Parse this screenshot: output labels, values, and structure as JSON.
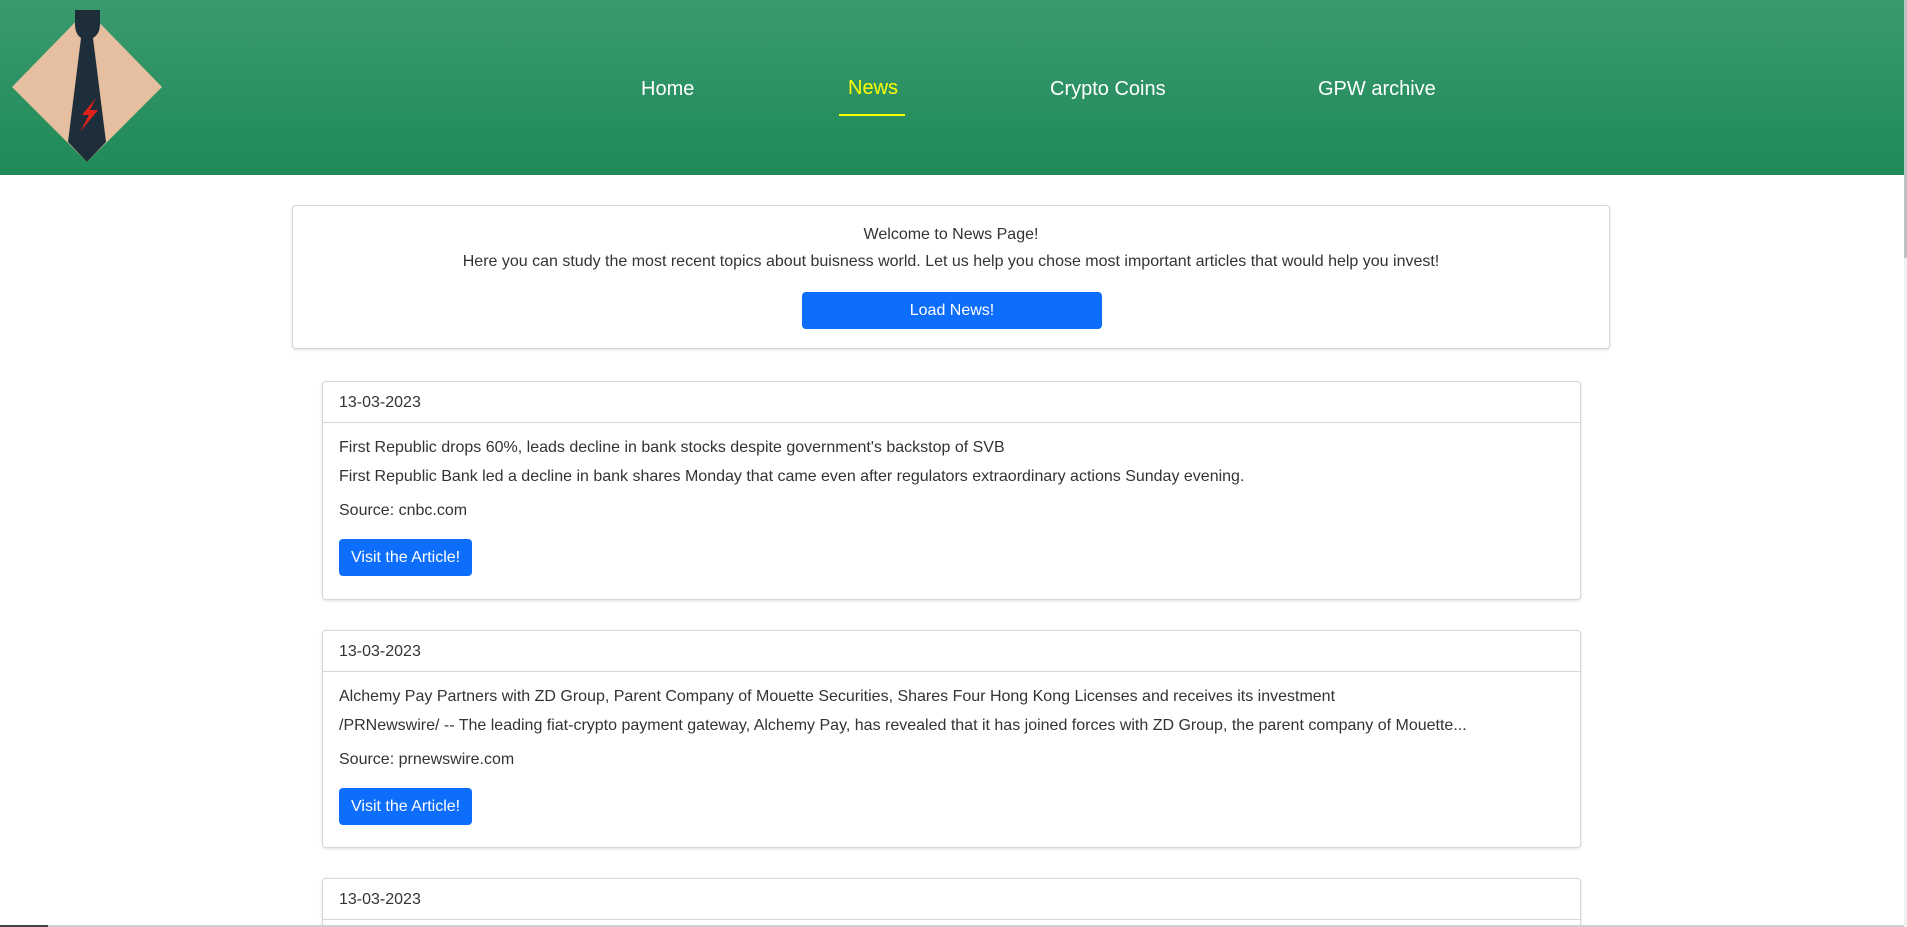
{
  "nav": {
    "items": [
      {
        "label": "Home"
      },
      {
        "label": "News"
      },
      {
        "label": "Crypto Coins"
      },
      {
        "label": "GPW archive"
      }
    ],
    "active": "News"
  },
  "logo": {
    "icon": "tie-logo-icon"
  },
  "welcome": {
    "title": "Welcome to News Page!",
    "text": "Here you can study the most recent topics about buisness world. Let us help you chose most important articles that would help you invest!",
    "button_label": "Load News!"
  },
  "articles": [
    {
      "date": "13-03-2023",
      "title": "First Republic drops 60%, leads decline in bank stocks despite government's backstop of SVB",
      "description": "First Republic Bank led a decline in bank shares Monday that came even after regulators extraordinary actions Sunday evening.",
      "source": "Source: cnbc.com",
      "button_label": "Visit the Article!"
    },
    {
      "date": "13-03-2023",
      "title": "Alchemy Pay Partners with ZD Group, Parent Company of Mouette Securities, Shares Four Hong Kong Licenses and receives its investment",
      "description": "/PRNewswire/ -- The leading fiat-crypto payment gateway, Alchemy Pay, has revealed that it has joined forces with ZD Group, the parent company of Mouette...",
      "source": "Source: prnewswire.com",
      "button_label": "Visit the Article!"
    },
    {
      "date": "13-03-2023"
    }
  ],
  "colors": {
    "header_top": "#3a9a6e",
    "header_bottom": "#1f8a58",
    "nav_active": "#ffff00",
    "primary_button": "#0d6efd",
    "logo_diamond": "#e6bfa0",
    "tie": "#1e2d3a",
    "bolt": "#e0201b"
  }
}
